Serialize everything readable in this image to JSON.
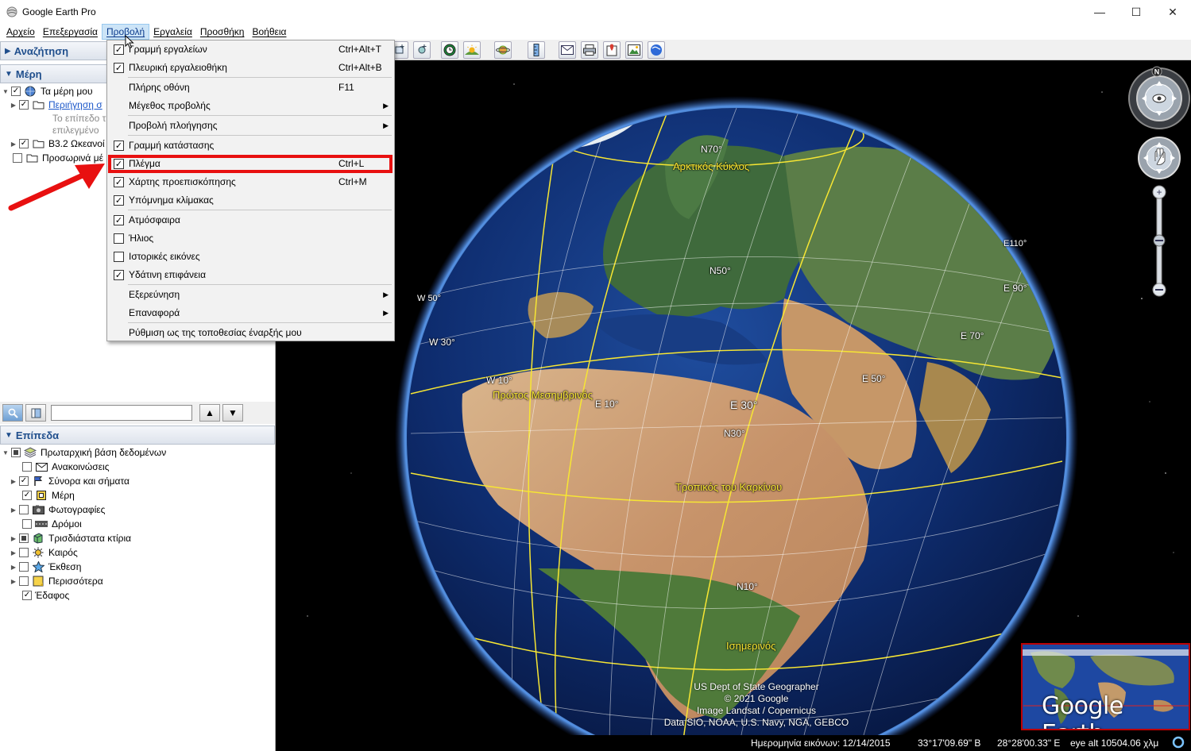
{
  "window": {
    "title": "Google Earth Pro",
    "controls": {
      "minimize": "—",
      "maximize": "☐",
      "close": "✕"
    }
  },
  "menubar": {
    "items": [
      {
        "label": "Αρχείο"
      },
      {
        "label": "Επεξεργασία"
      },
      {
        "label": "Προβολή"
      },
      {
        "label": "Εργαλεία"
      },
      {
        "label": "Προσθήκη"
      },
      {
        "label": "Βοήθεια"
      }
    ]
  },
  "view_menu": {
    "items": [
      {
        "label": "Γραμμή εργαλείων",
        "checked": true,
        "shortcut": "Ctrl+Alt+T"
      },
      {
        "label": "Πλευρική εργαλειοθήκη",
        "checked": true,
        "shortcut": "Ctrl+Alt+B"
      },
      {
        "label": "Πλήρης οθόνη",
        "shortcut": "F11"
      },
      {
        "label": "Μέγεθος προβολής",
        "submenu": true
      },
      {
        "label": "Προβολή πλοήγησης",
        "submenu": true
      },
      {
        "label": "Γραμμή κατάστασης",
        "checked": true
      },
      {
        "label": "Πλέγμα",
        "checked": true,
        "shortcut": "Ctrl+L"
      },
      {
        "label": "Χάρτης προεπισκόπησης",
        "checked": true,
        "shortcut": "Ctrl+M"
      },
      {
        "label": "Υπόμνημα κλίμακας",
        "checked": true
      },
      {
        "label": "Ατμόσφαιρα",
        "checked": true
      },
      {
        "label": "Ήλιος",
        "checked": false
      },
      {
        "label": "Ιστορικές εικόνες",
        "checked": false
      },
      {
        "label": "Υδάτινη επιφάνεια",
        "checked": true
      },
      {
        "label": "Εξερεύνηση",
        "submenu": true
      },
      {
        "label": "Επαναφορά",
        "submenu": true
      },
      {
        "label": "Ρύθμιση ως της τοποθεσίας έναρξής μου"
      }
    ]
  },
  "sidebar": {
    "search_header": "Αναζήτηση",
    "places_header": "Μέρη",
    "places": {
      "my_places": "Τα μέρη μου",
      "sightseeing": "Περιήγηση σ",
      "sightseeing_note_1": "Το επίπεδο τ",
      "sightseeing_note_2": "επιλεγμένο",
      "oceans": "B3.2 Ωκεανοί",
      "temporary": "Προσωρινά μέ"
    },
    "layers_header": "Επίπεδα",
    "layers": [
      {
        "label": "Πρωταρχική βάση δεδομένων",
        "icon": "layers-icon"
      },
      {
        "label": "Ανακοινώσεις",
        "icon": "envelope-icon"
      },
      {
        "label": "Σύνορα και σήματα",
        "icon": "flag-icon"
      },
      {
        "label": "Μέρη",
        "icon": "places-icon"
      },
      {
        "label": "Φωτογραφίες",
        "icon": "photo-icon"
      },
      {
        "label": "Δρόμοι",
        "icon": "road-icon"
      },
      {
        "label": "Τρισδιάστατα κτίρια",
        "icon": "building-icon"
      },
      {
        "label": "Καιρός",
        "icon": "weather-icon"
      },
      {
        "label": "Έκθεση",
        "icon": "gallery-icon"
      },
      {
        "label": "Περισσότερα",
        "icon": "folder-icon"
      },
      {
        "label": "Έδαφος",
        "icon": "terrain-icon"
      }
    ]
  },
  "map_labels": {
    "grid": [
      "N70°",
      "N50°",
      "N30°",
      "N10°",
      "W 50°",
      "W 30°",
      "W 10°",
      "E 10°",
      "E 30°",
      "E 50°",
      "E 70°",
      "E 90°",
      "E110°"
    ],
    "arctic_circle": "Αρκτικός Κύκλος",
    "prime_meridian": "Πρώτος Μεσημβρινός",
    "tropic_cancer": "Τροπικός του Καρκίνου",
    "equator": "Ισημερινός",
    "compass_north": "N"
  },
  "attribution": [
    "US Dept of State Geographer",
    "© 2021 Google",
    "Image Landsat / Copernicus",
    "Data SIO, NOAA, U.S. Navy, NGA, GEBCO"
  ],
  "overview_map": {
    "brand": "Google Earth"
  },
  "statusbar": {
    "imagery_date": "Ημερομηνία εικόνων: 12/14/2015",
    "latitude": "33°17'09.69\" B",
    "longitude": "28°28'00.33\" E",
    "eye_alt": "eye alt 10504.06 χλμ"
  },
  "colors": {
    "grid_yellow": "#f7e633",
    "highlight_red": "#e81010",
    "menu_active": "#cce4f7"
  }
}
